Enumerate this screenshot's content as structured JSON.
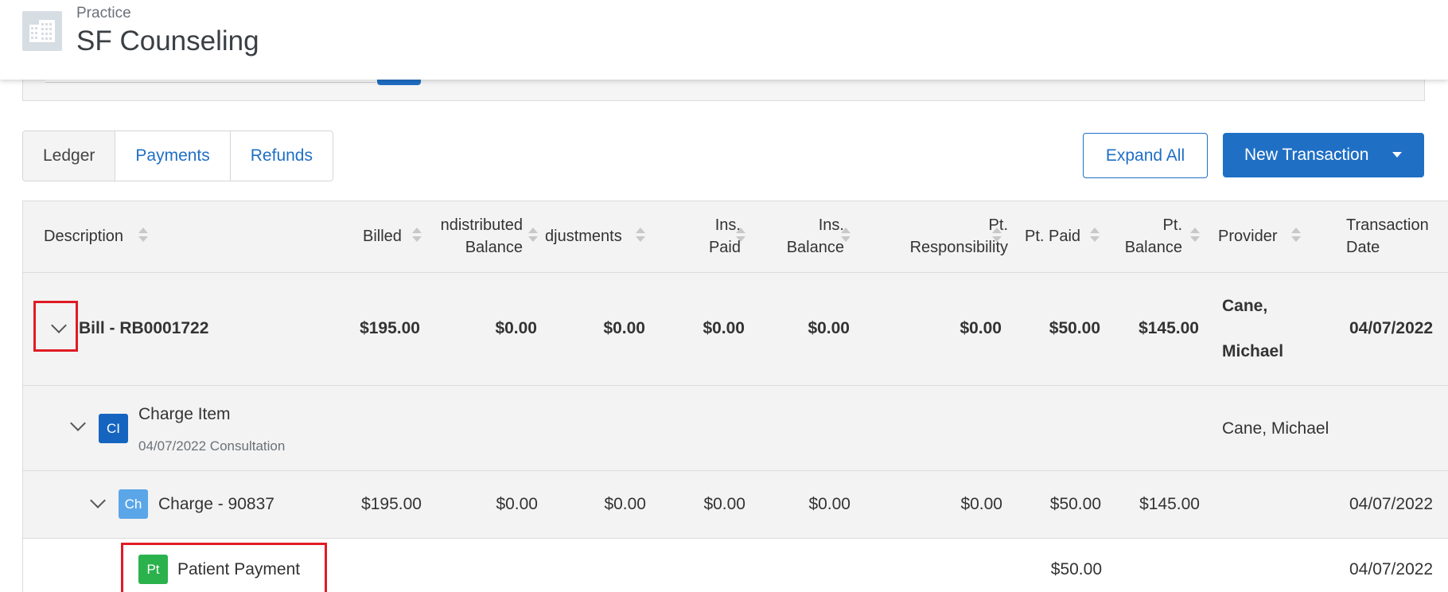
{
  "header": {
    "practice_label": "Practice",
    "practice_name": "SF Counseling",
    "logo_icon": "building-icon"
  },
  "tabs": [
    {
      "label": "Ledger"
    },
    {
      "label": "Payments"
    },
    {
      "label": "Refunds"
    }
  ],
  "actions": {
    "expand_all": "Expand All",
    "new_transaction": "New Transaction"
  },
  "columns": {
    "description": "Description",
    "billed": "Billed",
    "undistributed_1": "ndistributed",
    "undistributed_2": "Balance",
    "adjustments": "djustments",
    "ins_paid_1": "Ins.",
    "ins_paid_2": "Paid",
    "ins_balance_1": "Ins.",
    "ins_balance_2": "Balance",
    "pt_resp_1": "Pt.",
    "pt_resp_2": "Responsibility",
    "pt_paid": "Pt. Paid",
    "pt_balance_1": "Pt.",
    "pt_balance_2": "Balance",
    "provider": "Provider",
    "date_1": "Transaction",
    "date_2": "Date"
  },
  "rows": {
    "bill": {
      "description": "Bill - RB0001722",
      "billed": "$195.00",
      "undistributed": "$0.00",
      "adjustments": "$0.00",
      "ins_paid": "$0.00",
      "ins_balance": "$0.00",
      "pt_resp": "$0.00",
      "pt_paid": "$50.00",
      "pt_balance": "$145.00",
      "provider_1": "Cane,",
      "provider_2": "Michael",
      "date": "04/07/2022"
    },
    "charge_item": {
      "badge": "CI",
      "title": "Charge Item",
      "subtitle": "04/07/2022 Consultation",
      "provider": "Cane, Michael"
    },
    "charge": {
      "badge": "Ch",
      "description": "Charge - 90837",
      "billed": "$195.00",
      "undistributed": "$0.00",
      "adjustments": "$0.00",
      "ins_paid": "$0.00",
      "ins_balance": "$0.00",
      "pt_resp": "$0.00",
      "pt_paid": "$50.00",
      "pt_balance": "$145.00",
      "date": "04/07/2022"
    },
    "patient_payment": {
      "badge": "Pt",
      "description": "Patient Payment",
      "pt_paid": "$50.00",
      "date": "04/07/2022"
    }
  },
  "colors": {
    "primary": "#1f6fc5",
    "highlight": "#e01b24",
    "badge_ci": "#1565c0",
    "badge_ch": "#5aa6e8",
    "badge_pt": "#2bb24c"
  }
}
